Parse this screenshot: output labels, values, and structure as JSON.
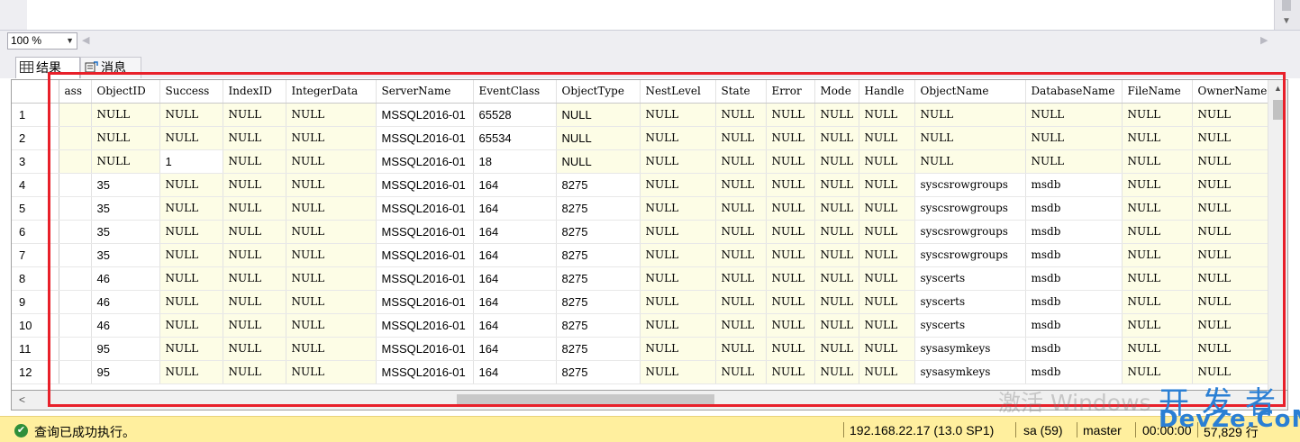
{
  "zoom": {
    "value": "100 %"
  },
  "tabs": {
    "results": "结果",
    "messages": "消息"
  },
  "grid": {
    "columns": [
      "",
      "ass",
      "ObjectID",
      "Success",
      "IndexID",
      "IntegerData",
      "ServerName",
      "EventClass",
      "ObjectType",
      "NestLevel",
      "State",
      "Error",
      "Mode",
      "Handle",
      "ObjectName",
      "DatabaseName",
      "FileName",
      "OwnerName"
    ],
    "rows": [
      [
        "1",
        "",
        "NULL",
        "NULL",
        "NULL",
        "NULL",
        "MSSQL2016-01",
        "65528",
        "NULL",
        "NULL",
        "NULL",
        "NULL",
        "NULL",
        "NULL",
        "NULL",
        "NULL",
        "NULL",
        "NULL"
      ],
      [
        "2",
        "",
        "NULL",
        "NULL",
        "NULL",
        "NULL",
        "MSSQL2016-01",
        "65534",
        "NULL",
        "NULL",
        "NULL",
        "NULL",
        "NULL",
        "NULL",
        "NULL",
        "NULL",
        "NULL",
        "NULL"
      ],
      [
        "3",
        "",
        "NULL",
        "1",
        "NULL",
        "NULL",
        "MSSQL2016-01",
        "18",
        "NULL",
        "NULL",
        "NULL",
        "NULL",
        "NULL",
        "NULL",
        "NULL",
        "NULL",
        "NULL",
        "NULL"
      ],
      [
        "4",
        "",
        "35",
        "NULL",
        "NULL",
        "NULL",
        "MSSQL2016-01",
        "164",
        "8275",
        "NULL",
        "NULL",
        "NULL",
        "NULL",
        "NULL",
        "syscsrowgroups",
        "msdb",
        "NULL",
        "NULL"
      ],
      [
        "5",
        "",
        "35",
        "NULL",
        "NULL",
        "NULL",
        "MSSQL2016-01",
        "164",
        "8275",
        "NULL",
        "NULL",
        "NULL",
        "NULL",
        "NULL",
        "syscsrowgroups",
        "msdb",
        "NULL",
        "NULL"
      ],
      [
        "6",
        "",
        "35",
        "NULL",
        "NULL",
        "NULL",
        "MSSQL2016-01",
        "164",
        "8275",
        "NULL",
        "NULL",
        "NULL",
        "NULL",
        "NULL",
        "syscsrowgroups",
        "msdb",
        "NULL",
        "NULL"
      ],
      [
        "7",
        "",
        "35",
        "NULL",
        "NULL",
        "NULL",
        "MSSQL2016-01",
        "164",
        "8275",
        "NULL",
        "NULL",
        "NULL",
        "NULL",
        "NULL",
        "syscsrowgroups",
        "msdb",
        "NULL",
        "NULL"
      ],
      [
        "8",
        "",
        "46",
        "NULL",
        "NULL",
        "NULL",
        "MSSQL2016-01",
        "164",
        "8275",
        "NULL",
        "NULL",
        "NULL",
        "NULL",
        "NULL",
        "syscerts",
        "msdb",
        "NULL",
        "NULL"
      ],
      [
        "9",
        "",
        "46",
        "NULL",
        "NULL",
        "NULL",
        "MSSQL2016-01",
        "164",
        "8275",
        "NULL",
        "NULL",
        "NULL",
        "NULL",
        "NULL",
        "syscerts",
        "msdb",
        "NULL",
        "NULL"
      ],
      [
        "10",
        "",
        "46",
        "NULL",
        "NULL",
        "NULL",
        "MSSQL2016-01",
        "164",
        "8275",
        "NULL",
        "NULL",
        "NULL",
        "NULL",
        "NULL",
        "syscerts",
        "msdb",
        "NULL",
        "NULL"
      ],
      [
        "11",
        "",
        "95",
        "NULL",
        "NULL",
        "NULL",
        "MSSQL2016-01",
        "164",
        "8275",
        "NULL",
        "NULL",
        "NULL",
        "NULL",
        "NULL",
        "sysasymkeys",
        "msdb",
        "NULL",
        "NULL"
      ],
      [
        "12",
        "",
        "95",
        "NULL",
        "NULL",
        "NULL",
        "MSSQL2016-01",
        "164",
        "8275",
        "NULL",
        "NULL",
        "NULL",
        "NULL",
        "NULL",
        "sysasymkeys",
        "msdb",
        "NULL",
        "NULL"
      ]
    ]
  },
  "watermark": {
    "windows": "激活 Windows",
    "brand_cn": "开发者",
    "brand_en": "DevZe.CoM"
  },
  "status": {
    "message": "查询已成功执行。",
    "server": "192.168.22.17 (13.0 SP1)",
    "user": "sa (59)",
    "database": "master",
    "time": "00:00:00",
    "rows": "57,829 行"
  },
  "colors": {
    "highlight": "#e8202a",
    "status_bar": "#ffef9e",
    "null_cell": "#fdfde6"
  }
}
